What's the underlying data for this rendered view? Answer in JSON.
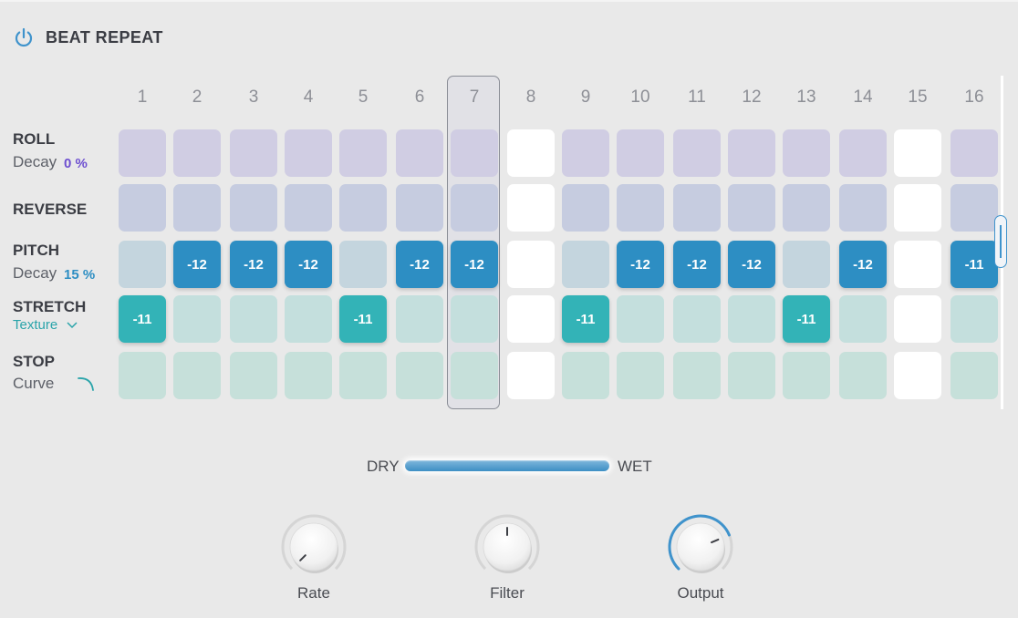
{
  "title": "BEAT REPEAT",
  "icons": {
    "power": "power-icon",
    "texture_menu": "chevron-down-icon",
    "curve": "curve-icon"
  },
  "colors": {
    "accent_blue": "#2d8ec3",
    "accent_teal": "#33b3b7",
    "roll_cell": "#d0cde3",
    "reverse_cell": "#c6cce0",
    "pitch_cell": "#c4d5de",
    "stretch_cell": "#c4dfdd",
    "stop_cell": "#c6e0da",
    "inactive_step": "#ffffff"
  },
  "steps": [
    "1",
    "2",
    "3",
    "4",
    "5",
    "6",
    "7",
    "8",
    "9",
    "10",
    "11",
    "12",
    "13",
    "14",
    "15",
    "16"
  ],
  "selected_step": "7",
  "inactive_steps": [
    "8",
    "15"
  ],
  "rows": [
    {
      "label": "ROLL",
      "sub_label": "Decay",
      "sub_value": "0 %",
      "values": [
        "",
        "",
        "",
        "",
        "",
        "",
        "",
        "",
        "",
        "",
        "",
        "",
        "",
        "",
        "",
        ""
      ]
    },
    {
      "label": "REVERSE",
      "values": [
        "",
        "",
        "",
        "",
        "",
        "",
        "",
        "",
        "",
        "",
        "",
        "",
        "",
        "",
        "",
        ""
      ]
    },
    {
      "label": "PITCH",
      "sub_label": "Decay",
      "sub_value": "15 %",
      "values": [
        "",
        "-12",
        "-12",
        "-12",
        "",
        "-12",
        "-12",
        "",
        "",
        "-12",
        "-12",
        "-12",
        "",
        "-12",
        "",
        "-11"
      ]
    },
    {
      "label": "STRETCH",
      "sub_label": "Texture",
      "values": [
        "-11",
        "",
        "",
        "",
        "-11",
        "",
        "",
        "",
        "-11",
        "",
        "",
        "",
        "-11",
        "",
        "",
        ""
      ]
    },
    {
      "label": "STOP",
      "sub_label": "Curve",
      "values": [
        "",
        "",
        "",
        "",
        "",
        "",
        "",
        "",
        "",
        "",
        "",
        "",
        "",
        "",
        "",
        ""
      ]
    }
  ],
  "mix": {
    "left_label": "DRY",
    "right_label": "WET",
    "value": 1.0
  },
  "knobs": [
    {
      "label": "Rate",
      "value": 0.0,
      "has_arc": false
    },
    {
      "label": "Filter",
      "value": 0.5,
      "has_arc": false
    },
    {
      "label": "Output",
      "value": 0.75,
      "has_arc": true
    }
  ]
}
